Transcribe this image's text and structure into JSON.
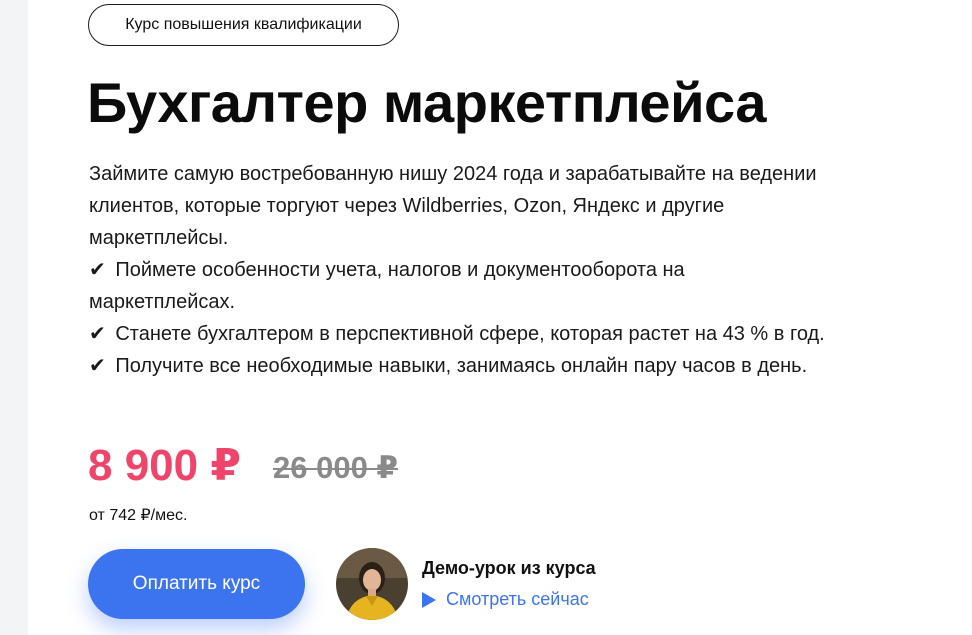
{
  "badge": {
    "label": "Курс повышения квалификации"
  },
  "course": {
    "title": "Бухгалтер маркетплейса",
    "description_lines": [
      "Займите самую востребованную нишу 2024 года и зарабатывайте на ведении",
      "клиентов, которые торгуют через Wildberries, Ozon, Яндекс и другие",
      "маркетплейсы."
    ],
    "benefits": [
      {
        "check": "✔",
        "lines": [
          "Поймете особенности учета, налогов и документооборота на",
          "маркетплейсах."
        ]
      },
      {
        "check": "✔",
        "lines": [
          "Станете бухгалтером в перспективной сфере, которая растет на 43 % в год."
        ]
      },
      {
        "check": "✔",
        "lines": [
          "Получите все необходимые навыки, занимаясь онлайн пару часов в день."
        ]
      }
    ]
  },
  "pricing": {
    "price": "8 900 ₽",
    "old_price": "26 000 ₽",
    "installment": "от 742 ₽/мес."
  },
  "actions": {
    "pay_label": "Оплатить курс"
  },
  "demo": {
    "title": "Демо-урок из курса",
    "link_label": "Смотреть сейчас"
  },
  "colors": {
    "accent": "#3c74f0",
    "price": "#f0456a",
    "old_price": "#8a8a8a"
  },
  "icons": [
    "check-icon",
    "play-icon"
  ]
}
